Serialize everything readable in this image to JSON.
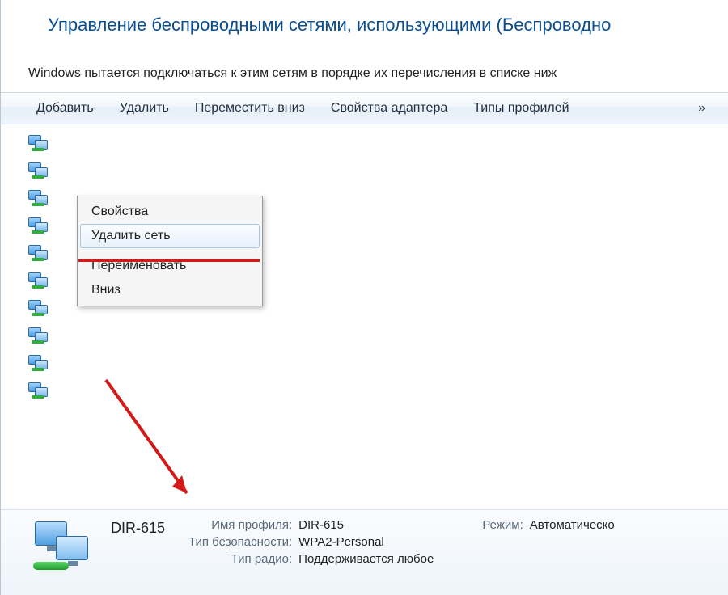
{
  "title": "Управление беспроводными сетями, использующими (Беспроводно",
  "description": "Windows пытается подключаться к этим сетям в порядке их перечисления в списке ниж",
  "toolbar": {
    "add": "Добавить",
    "remove": "Удалить",
    "move_down": "Переместить вниз",
    "adapter_props": "Свойства адаптера",
    "profile_types": "Типы профилей",
    "overflow": "»"
  },
  "context_menu": {
    "properties": "Свойства",
    "delete_network": "Удалить сеть",
    "rename": "Переименовать",
    "down": "Вниз"
  },
  "details": {
    "name": "DIR-615",
    "profile_label": "Имя профиля:",
    "profile_value": "DIR-615",
    "security_label": "Тип безопасности:",
    "security_value": "WPA2-Personal",
    "radio_label": "Тип радио:",
    "radio_value": "Поддерживается любое",
    "mode_label": "Режим:",
    "mode_value": "Автоматическо"
  }
}
